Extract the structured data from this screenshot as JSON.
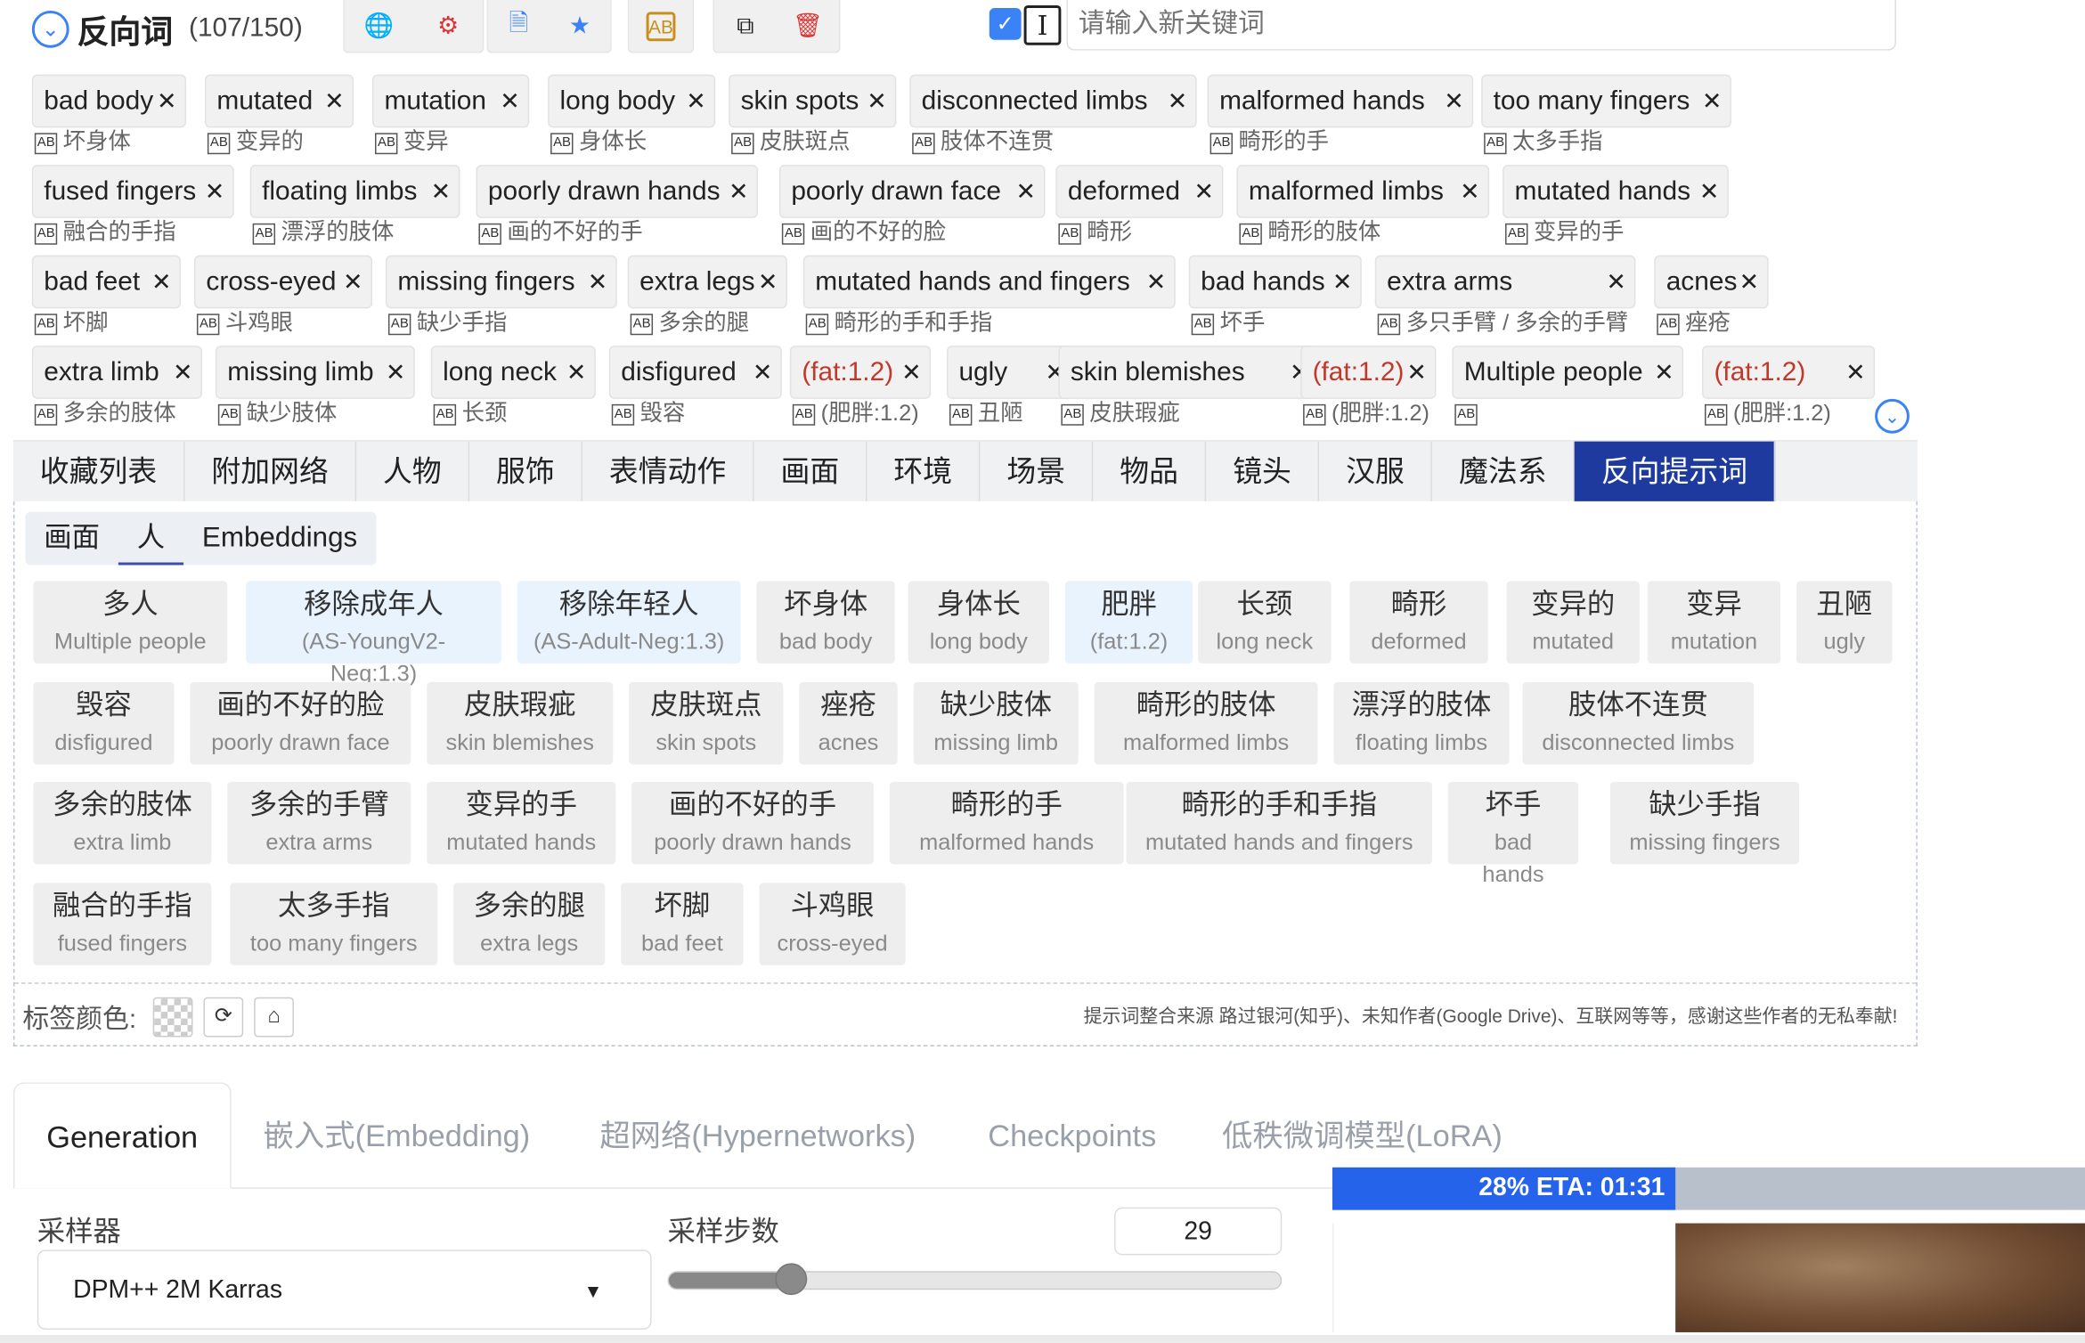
{
  "header": {
    "title": "反向词",
    "count": "(107/150)",
    "keyword_placeholder": "请输入新关键词"
  },
  "tag_rows": [
    [
      {
        "en": "bad body",
        "zh": "坏身体"
      },
      {
        "en": "mutated",
        "zh": "变异的"
      },
      {
        "en": "mutation",
        "zh": "变异"
      },
      {
        "en": "long body",
        "zh": "身体长"
      },
      {
        "en": "skin spots",
        "zh": "皮肤斑点"
      },
      {
        "en": "disconnected limbs",
        "zh": "肢体不连贯"
      },
      {
        "en": "malformed hands",
        "zh": "畸形的手"
      },
      {
        "en": "too many fingers",
        "zh": "太多手指"
      }
    ],
    [
      {
        "en": "fused fingers",
        "zh": "融合的手指"
      },
      {
        "en": "floating limbs",
        "zh": "漂浮的肢体"
      },
      {
        "en": "poorly drawn hands",
        "zh": "画的不好的手"
      },
      {
        "en": "poorly drawn face",
        "zh": "画的不好的脸"
      },
      {
        "en": "deformed",
        "zh": "畸形"
      },
      {
        "en": "malformed limbs",
        "zh": "畸形的肢体"
      },
      {
        "en": "mutated hands",
        "zh": "变异的手"
      }
    ],
    [
      {
        "en": "bad feet",
        "zh": "坏脚"
      },
      {
        "en": "cross-eyed",
        "zh": "斗鸡眼"
      },
      {
        "en": "missing fingers",
        "zh": "缺少手指"
      },
      {
        "en": "extra legs",
        "zh": "多余的腿"
      },
      {
        "en": "mutated hands and fingers",
        "zh": "畸形的手和手指"
      },
      {
        "en": "bad hands",
        "zh": "坏手"
      },
      {
        "en": "extra arms",
        "zh": "多只手臂 / 多余的手臂"
      },
      {
        "en": "acnes",
        "zh": "痤疮"
      }
    ],
    [
      {
        "en": "extra limb",
        "zh": "多余的肢体"
      },
      {
        "en": "missing limb",
        "zh": "缺少肢体"
      },
      {
        "en": "long neck",
        "zh": "长颈"
      },
      {
        "en": "disfigured",
        "zh": "毁容"
      },
      {
        "en": "(fat:1.2)",
        "zh": "(肥胖:1.2)"
      },
      {
        "en": "ugly",
        "zh": "丑陋"
      },
      {
        "en": "skin blemishes",
        "zh": "皮肤瑕疵"
      },
      {
        "en": "(fat:1.2)",
        "zh": "(肥胖:1.2)"
      },
      {
        "en": "Multiple people",
        "zh": ""
      },
      {
        "en": "(fat:1.2)",
        "zh": "(肥胖:1.2)"
      }
    ]
  ],
  "categories": [
    "收藏列表",
    "附加网络",
    "人物",
    "服饰",
    "表情动作",
    "画面",
    "环境",
    "场景",
    "物品",
    "镜头",
    "汉服",
    "魔法系",
    "反向提示词"
  ],
  "subtabs": [
    "画面",
    "人",
    "Embeddings"
  ],
  "buttons": [
    [
      {
        "zh": "多人",
        "en": "Multiple people"
      },
      {
        "zh": "移除成年人",
        "en": "(AS-YoungV2-Neg:1.3)"
      },
      {
        "zh": "移除年轻人",
        "en": "(AS-Adult-Neg:1.3)"
      },
      {
        "zh": "坏身体",
        "en": "bad body"
      },
      {
        "zh": "身体长",
        "en": "long body"
      },
      {
        "zh": "肥胖",
        "en": "(fat:1.2)"
      },
      {
        "zh": "长颈",
        "en": "long neck"
      },
      {
        "zh": "畸形",
        "en": "deformed"
      },
      {
        "zh": "变异的",
        "en": "mutated"
      },
      {
        "zh": "变异",
        "en": "mutation"
      },
      {
        "zh": "丑陋",
        "en": "ugly"
      }
    ],
    [
      {
        "zh": "毁容",
        "en": "disfigured"
      },
      {
        "zh": "画的不好的脸",
        "en": "poorly drawn face"
      },
      {
        "zh": "皮肤瑕疵",
        "en": "skin blemishes"
      },
      {
        "zh": "皮肤斑点",
        "en": "skin spots"
      },
      {
        "zh": "痤疮",
        "en": "acnes"
      },
      {
        "zh": "缺少肢体",
        "en": "missing limb"
      },
      {
        "zh": "畸形的肢体",
        "en": "malformed limbs"
      },
      {
        "zh": "漂浮的肢体",
        "en": "floating limbs"
      },
      {
        "zh": "肢体不连贯",
        "en": "disconnected limbs"
      }
    ],
    [
      {
        "zh": "多余的肢体",
        "en": "extra limb"
      },
      {
        "zh": "多余的手臂",
        "en": "extra arms"
      },
      {
        "zh": "变异的手",
        "en": "mutated hands"
      },
      {
        "zh": "画的不好的手",
        "en": "poorly drawn hands"
      },
      {
        "zh": "畸形的手",
        "en": "malformed hands"
      },
      {
        "zh": "畸形的手和手指",
        "en": "mutated hands and fingers"
      },
      {
        "zh": "坏手",
        "en": "bad hands"
      },
      {
        "zh": "缺少手指",
        "en": "missing fingers"
      }
    ],
    [
      {
        "zh": "融合的手指",
        "en": "fused fingers"
      },
      {
        "zh": "太多手指",
        "en": "too many fingers"
      },
      {
        "zh": "多余的腿",
        "en": "extra legs"
      },
      {
        "zh": "坏脚",
        "en": "bad feet"
      },
      {
        "zh": "斗鸡眼",
        "en": "cross-eyed"
      }
    ]
  ],
  "footer": {
    "color_label": "标签颜色:",
    "credits": "提示词整合来源 路过银河(知乎)、未知作者(Google Drive)、互联网等等，感谢这些作者的无私奉献!"
  },
  "gen_tabs": [
    "Generation",
    "嵌入式(Embedding)",
    "超网络(Hypernetworks)",
    "Checkpoints",
    "低秩微调模型(LoRA)"
  ],
  "sampler": {
    "label": "采样器",
    "value": "DPM++ 2M Karras"
  },
  "steps": {
    "label": "采样步数",
    "value": "29",
    "fraction": 0.2
  },
  "progress": {
    "text": "28% ETA: 01:31",
    "fraction": 0.28
  },
  "colors": {
    "accent": "#1e3a9e",
    "progress": "#2563eb",
    "highlight": "#e8f3fd"
  }
}
